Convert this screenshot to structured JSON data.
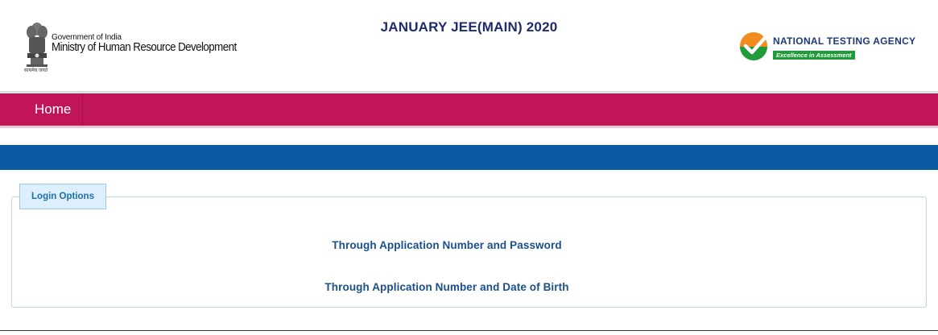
{
  "header": {
    "gov_small": "Government of India",
    "gov_big": "Ministry of Human Resource Development",
    "emblem_caption": "सत्यमेव जयते",
    "title": "JANUARY JEE(MAIN) 2020",
    "nta_name": "NATIONAL TESTING AGENCY",
    "nta_tagline": "Excellence in Assessment"
  },
  "nav": {
    "items": [
      {
        "label": "Home"
      }
    ]
  },
  "login": {
    "tab_label": "Login Options",
    "options": [
      {
        "label": "Through Application Number and Password"
      },
      {
        "label": "Through Application Number and Date of Birth"
      }
    ]
  },
  "colors": {
    "nav_bg": "#c01557",
    "band_bg": "#0b5aa2",
    "title_color": "#1f2a6e",
    "link_color": "#1a4f8a",
    "nta_green": "#1f9b3a",
    "nta_orange": "#f28c1e"
  },
  "icons": {
    "gov": "ashoka-emblem-icon",
    "nta": "nta-checkmark-logo-icon"
  }
}
